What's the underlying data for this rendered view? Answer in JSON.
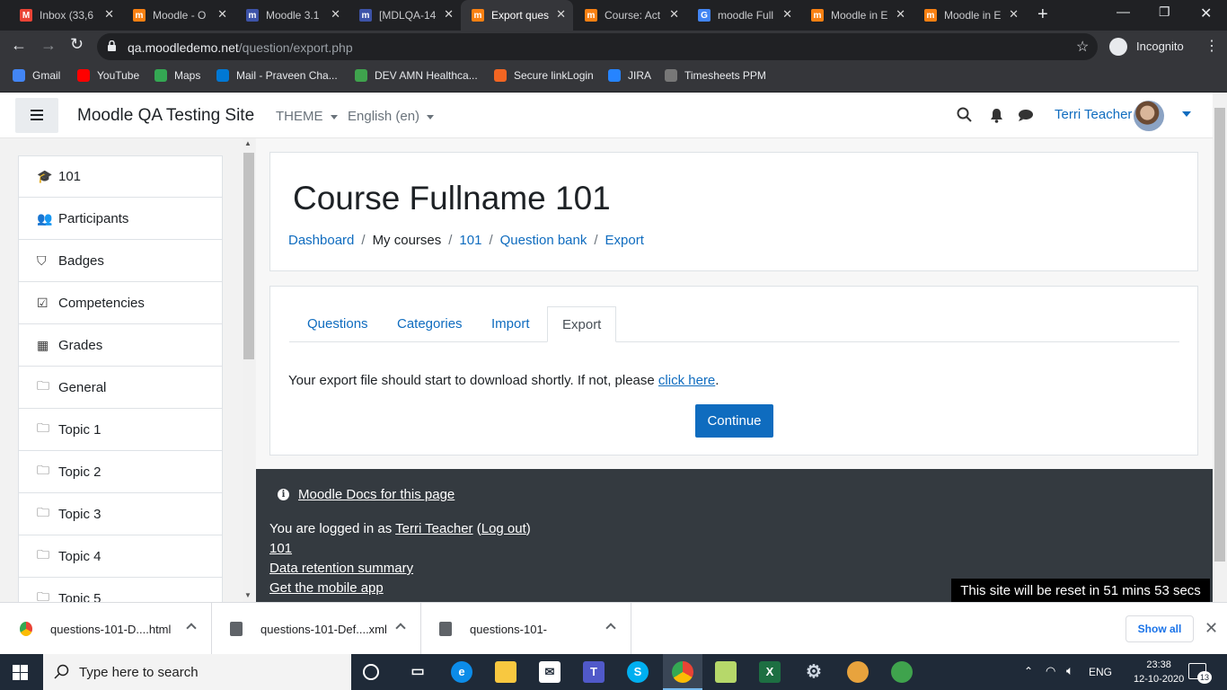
{
  "browser": {
    "tabs": [
      {
        "title": "Inbox (33,6",
        "fav": "M",
        "color": "#ea4335"
      },
      {
        "title": "Moodle - O",
        "fav": "m",
        "color": "#f98012"
      },
      {
        "title": "Moodle 3.1",
        "fav": "m",
        "color": "#3d53a8"
      },
      {
        "title": "[MDLQA-14",
        "fav": "m",
        "color": "#3d53a8"
      },
      {
        "title": "Export ques",
        "fav": "m",
        "color": "#f98012",
        "active": true
      },
      {
        "title": "Course: Act",
        "fav": "m",
        "color": "#f98012"
      },
      {
        "title": "moodle Full",
        "fav": "G",
        "color": "#4285f4"
      },
      {
        "title": "Moodle in E",
        "fav": "m",
        "color": "#f98012"
      },
      {
        "title": "Moodle in E",
        "fav": "m",
        "color": "#f98012"
      }
    ],
    "url_domain": "qa.moodledemo.net",
    "url_path": "/question/export.php",
    "incognito_label": "Incognito",
    "bookmarks": [
      {
        "label": "Gmail",
        "color": "#4285f4"
      },
      {
        "label": "YouTube",
        "color": "#ff0000"
      },
      {
        "label": "Maps",
        "color": "#34a853"
      },
      {
        "label": "Mail - Praveen Cha...",
        "color": "#0078d4"
      },
      {
        "label": "DEV AMN Healthca...",
        "color": "#3fa34d"
      },
      {
        "label": "Secure linkLogin",
        "color": "#f26522"
      },
      {
        "label": "JIRA",
        "color": "#2684ff"
      },
      {
        "label": "Timesheets PPM",
        "color": "#777777"
      }
    ]
  },
  "navbar": {
    "site_name": "Moodle QA Testing Site",
    "theme_label": "THEME",
    "language_label": "English (en)",
    "user_name": "Terri Teacher"
  },
  "drawer": {
    "items": [
      {
        "label": "101",
        "icon": "graduation-cap-icon",
        "glyph": "🎓"
      },
      {
        "label": "Participants",
        "icon": "users-icon",
        "glyph": "👥"
      },
      {
        "label": "Badges",
        "icon": "shield-icon",
        "glyph": "⛉"
      },
      {
        "label": "Competencies",
        "icon": "check-square-icon",
        "glyph": "☑"
      },
      {
        "label": "Grades",
        "icon": "table-icon",
        "glyph": "▦"
      },
      {
        "label": "General",
        "icon": "folder-icon",
        "glyph": "🗀"
      },
      {
        "label": "Topic 1",
        "icon": "folder-icon",
        "glyph": "🗀"
      },
      {
        "label": "Topic 2",
        "icon": "folder-icon",
        "glyph": "🗀"
      },
      {
        "label": "Topic 3",
        "icon": "folder-icon",
        "glyph": "🗀"
      },
      {
        "label": "Topic 4",
        "icon": "folder-icon",
        "glyph": "🗀"
      },
      {
        "label": "Topic 5",
        "icon": "folder-icon",
        "glyph": "🗀"
      }
    ]
  },
  "page": {
    "course_title": "Course Fullname 101",
    "breadcrumb": [
      "Dashboard",
      "My courses",
      "101",
      "Question bank",
      "Export"
    ],
    "tabs": [
      "Questions",
      "Categories",
      "Import",
      "Export"
    ],
    "message_prefix": "Your export file should start to download shortly. If not, please ",
    "message_link": "click here",
    "message_suffix": ".",
    "continue_label": "Continue"
  },
  "footer": {
    "docs_link": "Moodle Docs for this page",
    "logged_in_prefix": "You are logged in as ",
    "logged_in_user": "Terri Teacher",
    "logout_link": "Log out",
    "course_link": "101",
    "data_retention_link": "Data retention summary",
    "mobile_app_link": "Get the mobile app",
    "reset_notice": "This site will be reset in 51 mins 53 secs"
  },
  "downloads": {
    "items": [
      "questions-101-D....html",
      "questions-101-Def....xml",
      "questions-101-"
    ],
    "show_all_label": "Show all"
  },
  "taskbar": {
    "search_placeholder": "Type here to search",
    "language": "ENG",
    "time": "23:38",
    "date": "12-10-2020",
    "notification_count": "13"
  }
}
